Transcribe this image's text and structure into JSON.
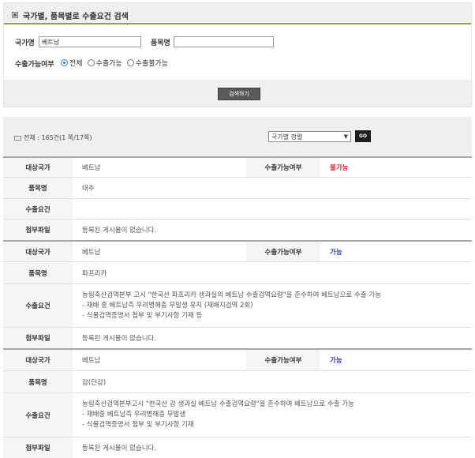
{
  "search": {
    "title": "국가별, 품목별로 수출요건 검색",
    "country_label": "국가명",
    "country_value": "베트남",
    "item_label": "품목명",
    "item_value": "",
    "export_label": "수출가능여부",
    "radio_all": "전체",
    "radio_possible": "수출가능",
    "radio_impossible": "수출불가능",
    "button": "검색하기"
  },
  "list": {
    "total": "전체 : 165건(1 쪽/17쪽)",
    "sort": "국가별 정렬",
    "go": "GO"
  },
  "records": [
    {
      "country_label": "대상국가",
      "country": "베트남",
      "status_label": "수출가능여부",
      "status": "불가능",
      "item_label": "품목명",
      "item": "대추",
      "req_label": "수출요건",
      "requirements": [],
      "attach_label": "첨부파일",
      "attach": "등록된 게시물이 없습니다."
    },
    {
      "country_label": "대상국가",
      "country": "베트남",
      "status_label": "수출가능여부",
      "status": "가능",
      "item_label": "품목명",
      "item": "파프리카",
      "req_label": "수출요건",
      "requirements": [
        "농림축산검역본부 고시 \"한국산 파프리카 생과실의 베트남 수출검역요령\"을 준수하여 베트남으로 수출 가능",
        "- 재배 중 베트남측 우려병해충 무발생 유지 (재배지검역 2회)",
        "- 식물검역증명서 첨부 및 부기사항 기재 등"
      ],
      "attach_label": "첨부파일",
      "attach": "등록된 게시물이 없습니다."
    },
    {
      "country_label": "대상국가",
      "country": "베트남",
      "status_label": "수출가능여부",
      "status": "가능",
      "item_label": "품목명",
      "item": "감(단감)",
      "req_label": "수출요건",
      "requirements": [
        "농림축산검역본부고시 \"한국산 감 생과실 베트남 수출검역요령\"을 준수하여 베트남으로 수출 가능",
        "- 재배중 베트남측 우려병해충 무발생",
        "- 식물검역증명서 첨부 및 부기사항 기재"
      ],
      "attach_label": "첨부파일",
      "attach": "등록된 게시물이 없습니다."
    }
  ],
  "colors": {
    "accent_line": "#8bab2b",
    "possible": "#2a3eb1",
    "impossible": "#d9262b"
  }
}
